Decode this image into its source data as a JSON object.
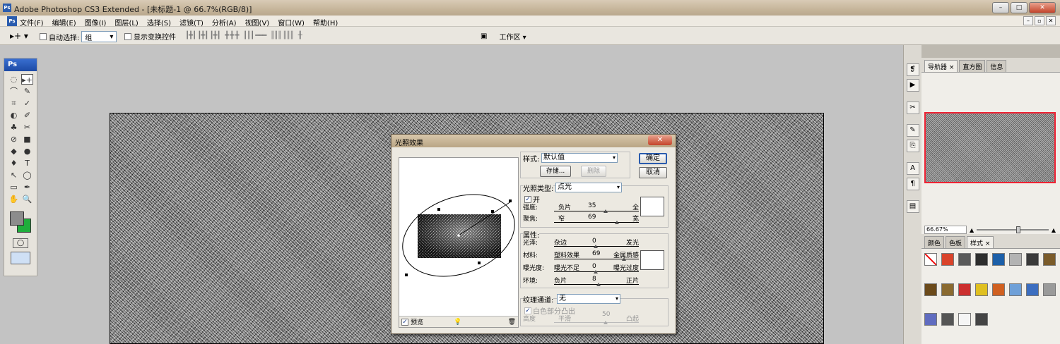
{
  "window": {
    "title": "Adobe Photoshop CS3 Extended - [未标题-1 @ 66.7%(RGB/8)]",
    "badge": "Ps",
    "buttons": [
      "–",
      "□",
      "✕"
    ]
  },
  "menubar": {
    "items": [
      "文件(F)",
      "编辑(E)",
      "图像(I)",
      "图层(L)",
      "选择(S)",
      "滤镜(T)",
      "分析(A)",
      "视图(V)",
      "窗口(W)",
      "帮助(H)"
    ],
    "mdi_buttons": [
      "–",
      "▫",
      "✕"
    ]
  },
  "options": {
    "auto_select_label": "自动选择:",
    "auto_select_value": "组",
    "show_transform_label": "显示变换控件",
    "workspace_label": "工作区 ▾"
  },
  "toolbox": {
    "header": "Ps",
    "tools": [
      "◌",
      "▸+",
      "⌒",
      "✎",
      "⌗",
      "✓",
      "◐",
      "✐",
      "♣",
      "✂",
      "⊘",
      "■",
      "◆",
      "●",
      "♦",
      "T",
      "↖",
      "◯",
      "▭",
      "✒",
      "✋",
      "🔍"
    ]
  },
  "right_panel": {
    "nav_tabs": [
      "导航器 ×",
      "直方图",
      "信息"
    ],
    "zoom": "66.67%",
    "style_tabs": [
      "颜色",
      "色板",
      "样式 ×"
    ],
    "swatch_colors": [
      "#ffffff",
      "#d9432a",
      "#5a5a5a",
      "#2d2d2d",
      "#1c5fa8",
      "#b3b3b3",
      "#3a3a3a",
      "#7a5b2a",
      "#6b4a1a",
      "#8a6a30",
      "#cc2f2f",
      "#e0c020",
      "#d06020",
      "#6fa0d8",
      "#3c6ec0",
      "#9a9a9a",
      "#606cc0",
      "#555555",
      "#f5f5f5",
      "#444444"
    ]
  },
  "dialog": {
    "title": "光照效果",
    "style_label": "样式:",
    "style_value": "默认值",
    "save_button": "存储...",
    "delete_button": "删除",
    "ok_button": "确定",
    "cancel_button": "取消",
    "light_type_label": "光照类型:",
    "light_type_value": "点光",
    "on_label": "开",
    "intensity": {
      "label": "强度:",
      "left": "负片",
      "value": "35",
      "right": "全"
    },
    "focus": {
      "label": "聚焦:",
      "left": "窄",
      "value": "69",
      "right": "宽"
    },
    "properties_label": "属性:",
    "gloss": {
      "label": "光泽:",
      "left": "杂边",
      "value": "0",
      "right": "发光"
    },
    "material": {
      "label": "材料:",
      "left": "塑料效果",
      "value": "69",
      "right": "金属质感"
    },
    "exposure": {
      "label": "曝光度:",
      "left": "曝光不足",
      "value": "0",
      "right": "曝光过度"
    },
    "ambience": {
      "label": "环境:",
      "left": "负片",
      "value": "8",
      "right": "正片"
    },
    "texture_label": "纹理通道:",
    "texture_value": "无",
    "white_high_label": "白色部分凸出",
    "height": {
      "label": "高度",
      "left": "平滑",
      "value": "50",
      "right": "凸起"
    },
    "preview_label": "预览"
  }
}
